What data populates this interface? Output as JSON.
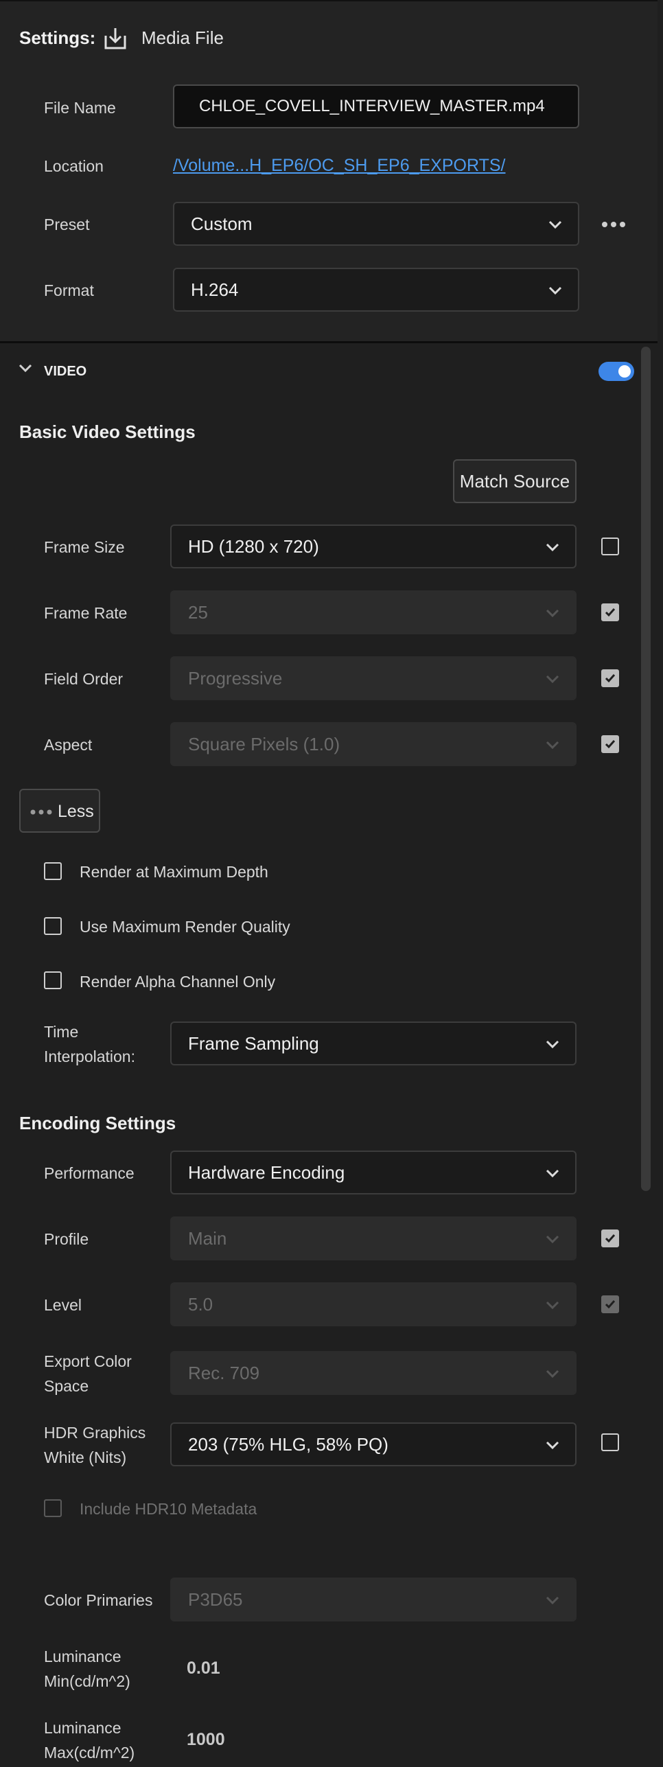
{
  "header": {
    "settings_label": "Settings:",
    "media_label": "Media File"
  },
  "file": {
    "file_name_label": "File Name",
    "file_name_value": "CHLOE_COVELL_INTERVIEW_MASTER.mp4",
    "location_label": "Location",
    "location_value": "/Volume...H_EP6/OC_SH_EP6_EXPORTS/",
    "preset_label": "Preset",
    "preset_value": "Custom",
    "format_label": "Format",
    "format_value": "H.264"
  },
  "video": {
    "section_label": "VIDEO",
    "enabled": true,
    "basic_title": "Basic Video Settings",
    "match_source_label": "Match Source",
    "frame_size_label": "Frame Size",
    "frame_size_value": "HD (1280 x 720)",
    "frame_rate_label": "Frame Rate",
    "frame_rate_value": "25",
    "field_order_label": "Field Order",
    "field_order_value": "Progressive",
    "aspect_label": "Aspect",
    "aspect_value": "Square Pixels (1.0)",
    "less_label": "Less",
    "render_max_depth_label": "Render at Maximum Depth",
    "max_render_quality_label": "Use Maximum Render Quality",
    "render_alpha_label": "Render Alpha Channel Only",
    "time_interp_label_1": "Time",
    "time_interp_label_2": "Interpolation:",
    "time_interp_value": "Frame Sampling"
  },
  "encoding": {
    "title": "Encoding Settings",
    "performance_label": "Performance",
    "performance_value": "Hardware Encoding",
    "profile_label": "Profile",
    "profile_value": "Main",
    "level_label": "Level",
    "level_value": "5.0",
    "color_space_label_1": "Export Color",
    "color_space_label_2": "Space",
    "color_space_value": "Rec. 709",
    "hdr_label_1": "HDR Graphics",
    "hdr_label_2": "White (Nits)",
    "hdr_value": "203 (75% HLG, 58% PQ)",
    "hdr10_label": "Include HDR10 Metadata",
    "primaries_label": "Color Primaries",
    "primaries_value": "P3D65",
    "lum_min_label_1": "Luminance",
    "lum_min_label_2": "Min(cd/m^2)",
    "lum_min_value": "0.01",
    "lum_max_label_1": "Luminance",
    "lum_max_label_2": "Max(cd/m^2)",
    "lum_max_value": "1000"
  },
  "colors": {
    "accent": "#3d86e8",
    "link": "#4d9bef",
    "background": "#1f1f1f"
  }
}
